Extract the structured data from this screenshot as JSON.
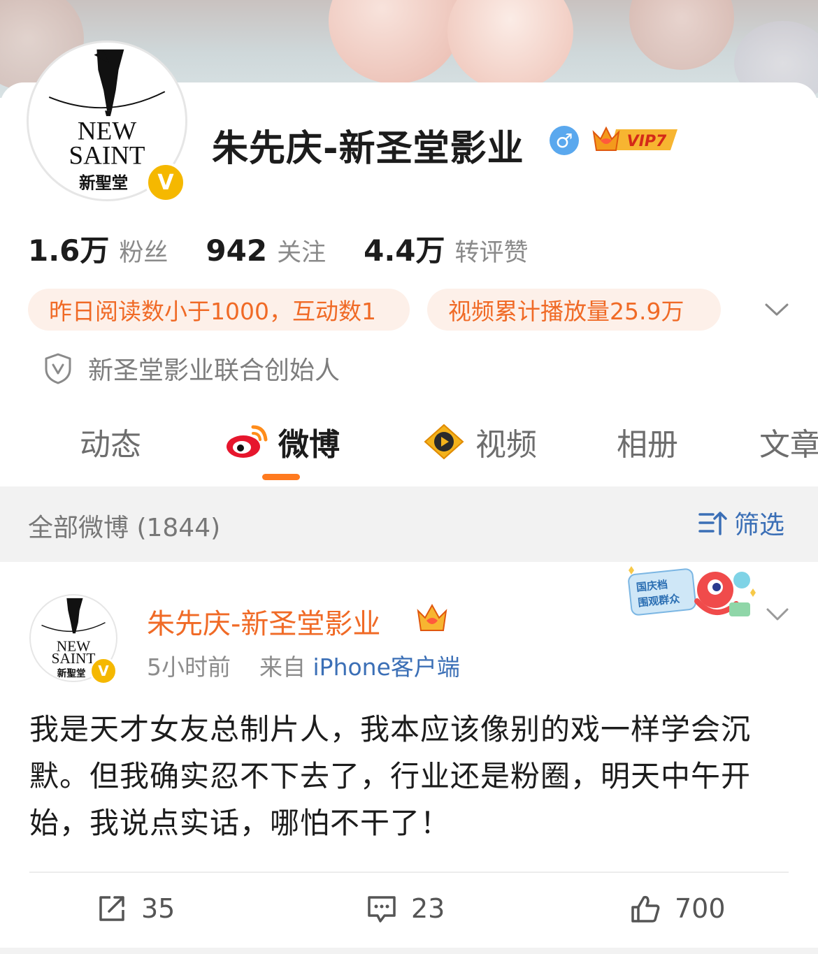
{
  "profile": {
    "name": "朱先庆-新圣堂影业",
    "gender_symbol": "♂",
    "vip_label": "VIP7",
    "verified_mark": "V",
    "logo_text": {
      "line1": "NEW",
      "line2": "SAINT",
      "line3": "新聖堂"
    }
  },
  "stats": [
    {
      "value": "1.6万",
      "label": "粉丝"
    },
    {
      "value": "942",
      "label": "关注"
    },
    {
      "value": "4.4万",
      "label": "转评赞"
    }
  ],
  "pills": [
    "昨日阅读数小于1000，互动数1",
    "视频累计播放量25.9万"
  ],
  "certification": "新圣堂影业联合创始人",
  "tabs": [
    {
      "label": "动态",
      "active": false
    },
    {
      "label": "微博",
      "active": true,
      "icon": "weibo-icon"
    },
    {
      "label": "视频",
      "active": false,
      "icon": "video-play-icon"
    },
    {
      "label": "相册",
      "active": false
    },
    {
      "label": "文章",
      "active": false
    }
  ],
  "filter": {
    "count_label": "全部微博 (1844)",
    "filter_label": "筛选"
  },
  "post": {
    "author": "朱先庆-新圣堂影业",
    "time": "5小时前",
    "source_prefix": "来自",
    "source": "iPhone客户端",
    "event_badge": "国庆档围观群众",
    "text": "我是天才女友总制片人，我本应该像别的戏一样学会沉默。但我确实忍不下去了，行业还是粉圈，明天中午开始，我说点实话，哪怕不干了！",
    "reposts": "35",
    "comments": "23",
    "likes": "700"
  },
  "colors": {
    "accent": "#f06a26",
    "link": "#3b6fb6",
    "pill_bg": "#fdf0e9",
    "verified": "#f5b800",
    "gender": "#5aa8ee"
  }
}
